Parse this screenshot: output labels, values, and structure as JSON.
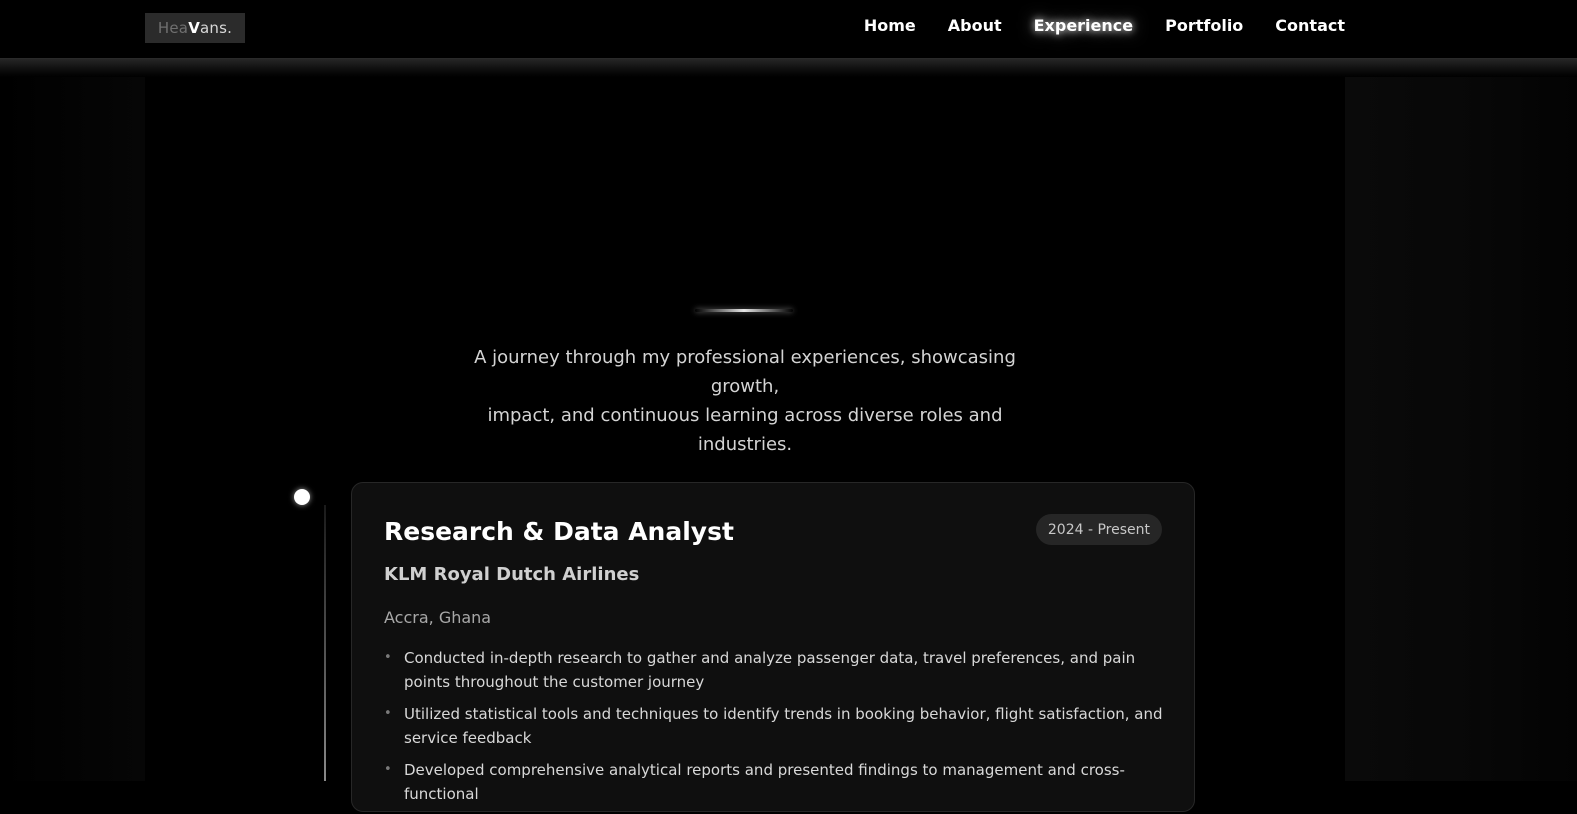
{
  "logo": {
    "dim": "Hea",
    "v": "V",
    "bright": "ans."
  },
  "nav": {
    "items": [
      {
        "label": "Home"
      },
      {
        "label": "About"
      },
      {
        "label": "Experience"
      },
      {
        "label": "Portfolio"
      },
      {
        "label": "Contact"
      }
    ],
    "active": "Experience"
  },
  "intro": {
    "line1": "A journey through my professional experiences, showcasing growth,",
    "line2": "impact, and continuous learning across diverse roles and industries."
  },
  "experience": [
    {
      "title": "Research & Data Analyst",
      "date": "2024 - Present",
      "company": "KLM Royal Dutch Airlines",
      "location": "Accra, Ghana",
      "bullets": [
        "Conducted in-depth research to gather and analyze passenger data, travel preferences, and pain points throughout the customer journey",
        "Utilized statistical tools and techniques to identify trends in booking behavior, flight satisfaction, and service feedback",
        "Developed comprehensive analytical reports and presented findings to management and cross-functional"
      ]
    }
  ],
  "colors": {
    "background": "#000000",
    "card": "#0f0f0f",
    "text": "#ffffff"
  }
}
